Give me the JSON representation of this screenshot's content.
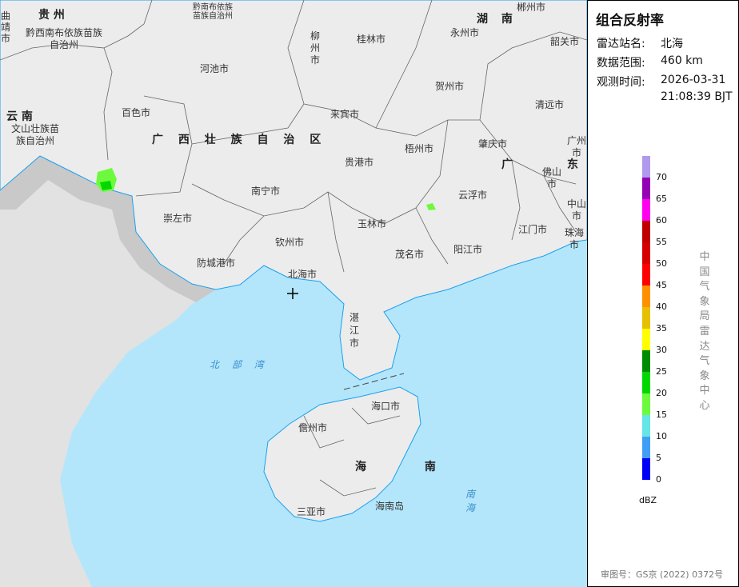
{
  "panel": {
    "title": "组合反射率",
    "rows": [
      {
        "label": "雷达站名:",
        "value": "北海"
      },
      {
        "label": "数据范围:",
        "value": "460 km"
      },
      {
        "label": "观测时间:",
        "value": "2026-03-31",
        "value2": "21:08:39 BJT"
      }
    ],
    "legend": {
      "unit": "dBZ",
      "ticks": [
        "70",
        "65",
        "60",
        "55",
        "50",
        "45",
        "40",
        "35",
        "30",
        "25",
        "20",
        "15",
        "10",
        "5",
        "0"
      ],
      "colors": [
        "#b09aee",
        "#9600b4",
        "#ff00f0",
        "#c00000",
        "#d60000",
        "#ff0000",
        "#ff9000",
        "#e7c000",
        "#ffff00",
        "#008c00",
        "#00d800",
        "#6efa3c",
        "#64e6e6",
        "#429ef5",
        "#0000f6"
      ]
    },
    "credit": "中国气象局雷达气象中心",
    "approval": "审图号：GS京 (2022) 0372号"
  },
  "map": {
    "provinces": [
      {
        "text": "贵 州"
      },
      {
        "text": "云 南"
      },
      {
        "text": "广 西 壮 族 自 治 区"
      },
      {
        "text": "湖 南"
      },
      {
        "text": "广"
      },
      {
        "text": "东"
      },
      {
        "text": "海 南"
      }
    ],
    "cities": [
      "曲靖市",
      "黔西南布依族苗族自治州",
      "黔南布依族苗族自治州",
      "柳州市",
      "桂林市",
      "永州市",
      "郴州市",
      "韶关市",
      "河池市",
      "贺州市",
      "百色市",
      "来宾市",
      "清远市",
      "文山壮族苗族自治州",
      "梧州市",
      "肇庆市",
      "广州市",
      "贵港市",
      "佛山市",
      "南宁市",
      "云浮市",
      "崇左市",
      "玉林市",
      "中山市",
      "江门市",
      "钦州市",
      "珠海市",
      "防城港市",
      "茂名市",
      "阳江市",
      "北海市",
      "湛江市",
      "海口市",
      "儋州市",
      "海南岛",
      "三亚市"
    ],
    "seas": [
      "北 部 湾",
      "南 海"
    ],
    "radar_site": "北海"
  }
}
